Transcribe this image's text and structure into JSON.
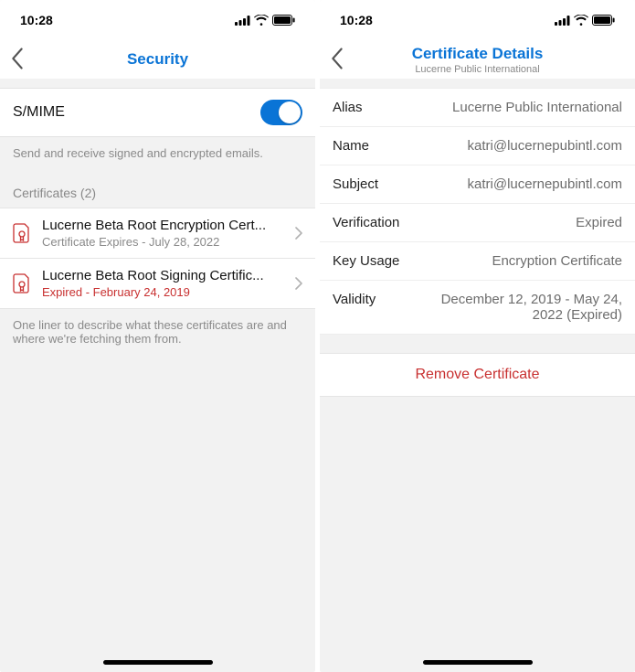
{
  "status": {
    "time": "10:28"
  },
  "left": {
    "title": "Security",
    "smime": {
      "label": "S/MIME",
      "caption": "Send and receive signed and encrypted emails."
    },
    "certs_header": "Certificates (2)",
    "certs": [
      {
        "title": "Lucerne Beta Root Encryption Cert...",
        "sub": "Certificate Expires - July 28, 2022",
        "expired": false
      },
      {
        "title": "Lucerne Beta Root Signing Certific...",
        "sub": "Expired - February 24, 2019",
        "expired": true
      }
    ],
    "footer": "One liner to describe what these certificates are and where we're fetching them from."
  },
  "right": {
    "title": "Certificate Details",
    "subtitle": "Lucerne Public International",
    "rows": [
      {
        "k": "Alias",
        "v": "Lucerne Public International"
      },
      {
        "k": "Name",
        "v": "katri@lucernepubintl.com"
      },
      {
        "k": "Subject",
        "v": "katri@lucernepubintl.com"
      },
      {
        "k": "Verification",
        "v": "Expired"
      },
      {
        "k": "Key Usage",
        "v": "Encryption Certificate"
      },
      {
        "k": "Validity",
        "v": "December 12, 2019 - May 24, 2022 (Expired)"
      }
    ],
    "remove": "Remove Certificate"
  }
}
